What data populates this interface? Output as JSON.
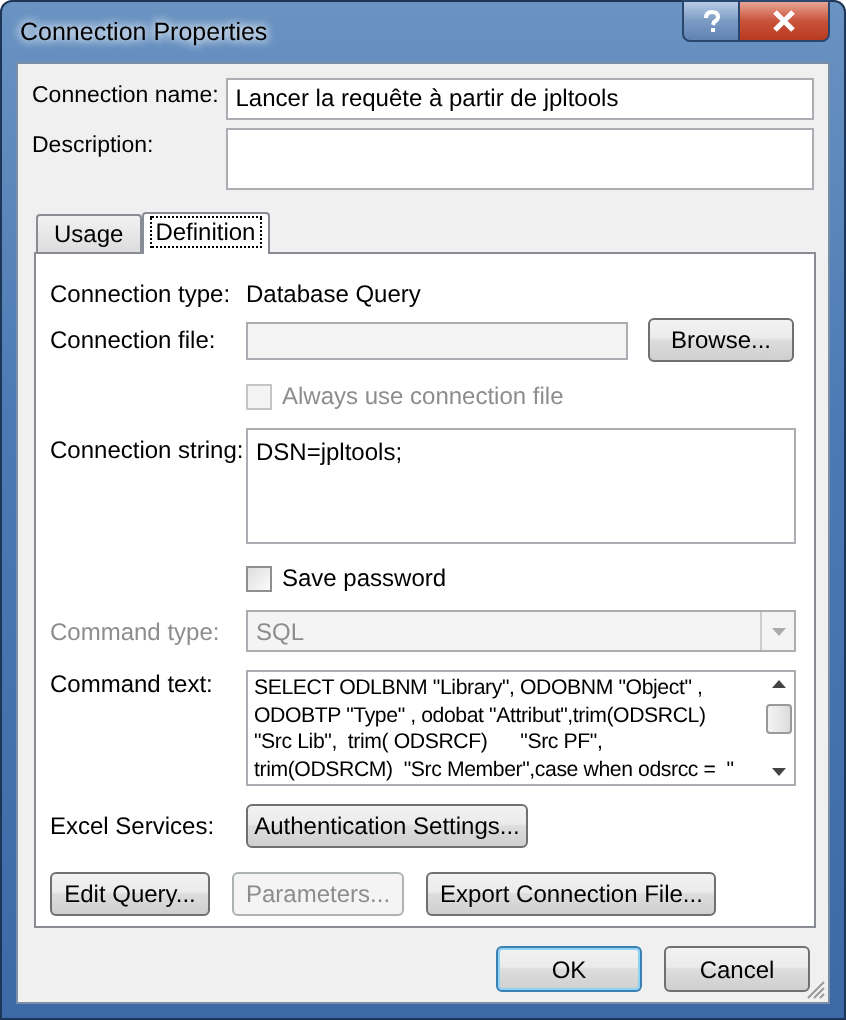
{
  "window": {
    "title": "Connection Properties"
  },
  "connection_name": {
    "label": "Connection name:",
    "value": "Lancer la requête à partir de jpltools"
  },
  "description": {
    "label": "Description:"
  },
  "tabs": [
    {
      "label": "Usage",
      "selected": false
    },
    {
      "label": "Definition",
      "selected": true
    }
  ],
  "definition": {
    "connection_type": {
      "label": "Connection type:",
      "value": "Database Query"
    },
    "connection_file": {
      "label": "Connection file:",
      "button": "Browse..."
    },
    "always_use_file": {
      "label": "Always use connection file",
      "checked": false,
      "disabled": true
    },
    "connection_string": {
      "label": "Connection string:",
      "value": "DSN=jpltools;"
    },
    "save_password": {
      "label": "Save password",
      "checked": false,
      "disabled": false
    },
    "command_type": {
      "label": "Command type:",
      "value": "SQL",
      "disabled": true
    },
    "command_text": {
      "label": "Command text:",
      "lines": [
        "SELECT ODLBNM \"Library\", ODOBNM \"Object\" ,",
        "ODOBTP \"Type\" , odobat \"Attribut\",trim(ODSRCL)",
        "\"Src Lib\",  trim( ODSRCF)      \"Src PF\",",
        "trim(ODSRCM)  \"Src Member\",case when odsrcc =  \""
      ]
    },
    "excel_services": {
      "label": "Excel Services:",
      "button": "Authentication Settings..."
    },
    "buttons": [
      {
        "label": "Edit Query...",
        "disabled": false
      },
      {
        "label": "Parameters...",
        "disabled": true
      },
      {
        "label": "Export Connection File...",
        "disabled": false
      }
    ]
  },
  "footer_buttons": [
    {
      "label": "OK",
      "default": true
    },
    {
      "label": "Cancel",
      "default": false
    }
  ]
}
